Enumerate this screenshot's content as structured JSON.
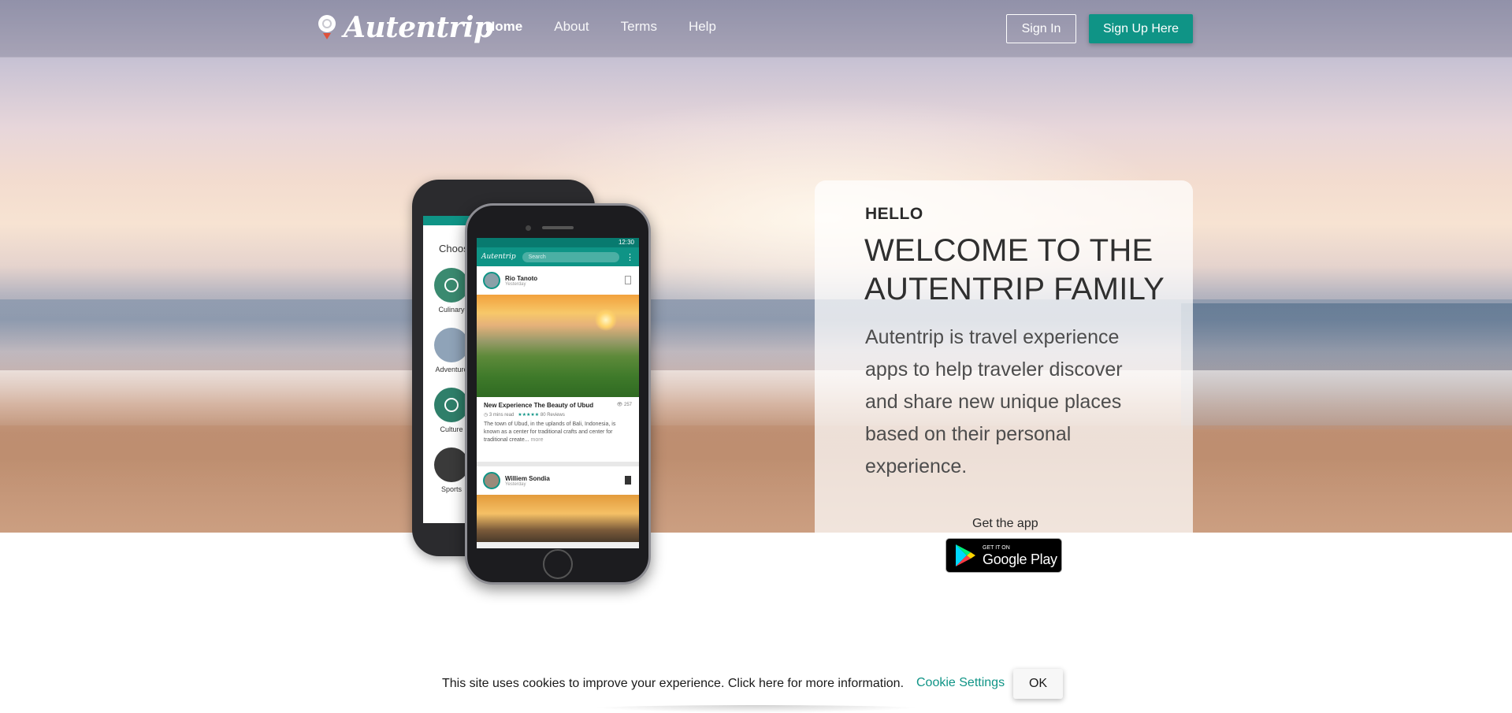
{
  "navbar": {
    "logo_text": "Autentrip",
    "links": [
      {
        "label": "Home",
        "active": true
      },
      {
        "label": "About",
        "active": false
      },
      {
        "label": "Terms",
        "active": false
      },
      {
        "label": "Help",
        "active": false
      }
    ],
    "signin_label": "Sign In",
    "signup_label": "Sign Up Here"
  },
  "hero": {
    "hello": "HELLO",
    "welcome_line1": "WELCOME TO THE",
    "welcome_line2": "AUTENTRIP FAMILY",
    "description": "Autentrip is travel experience apps to help traveler discover and share new unique places based on their personal experience.",
    "get_app": "Get the app",
    "google_play_small": "GET IT ON",
    "google_play_big": "Google Play"
  },
  "phone_back": {
    "choose_label": "Choose",
    "categories": [
      "Culinary",
      "Adventure",
      "Culture",
      "Sports"
    ]
  },
  "phone_front": {
    "status_time": "12:30",
    "app_logo": "Autentrip",
    "search_placeholder": "Search",
    "post1": {
      "author": "Rio Tanoto",
      "time": "Yesterday",
      "title": "New Experience The Beauty of Ubud",
      "views": "257",
      "read_time": "3 mins read",
      "stars": "★★★★★",
      "reviews": "80 Reviews",
      "text": "The town of Ubud, in the uplands of Bali, Indonesia, is known as a center for traditional crafts and center for traditional create...",
      "more": "more"
    },
    "post2": {
      "author": "Williem Sondia",
      "time": "Yesterday"
    }
  },
  "cookie": {
    "text": "This site uses cookies to improve your experience. Click here for more information.",
    "settings_label": "Cookie Settings",
    "ok_label": "OK"
  },
  "colors": {
    "accent": "#0f9486",
    "text_dark": "#2f2f2f"
  }
}
